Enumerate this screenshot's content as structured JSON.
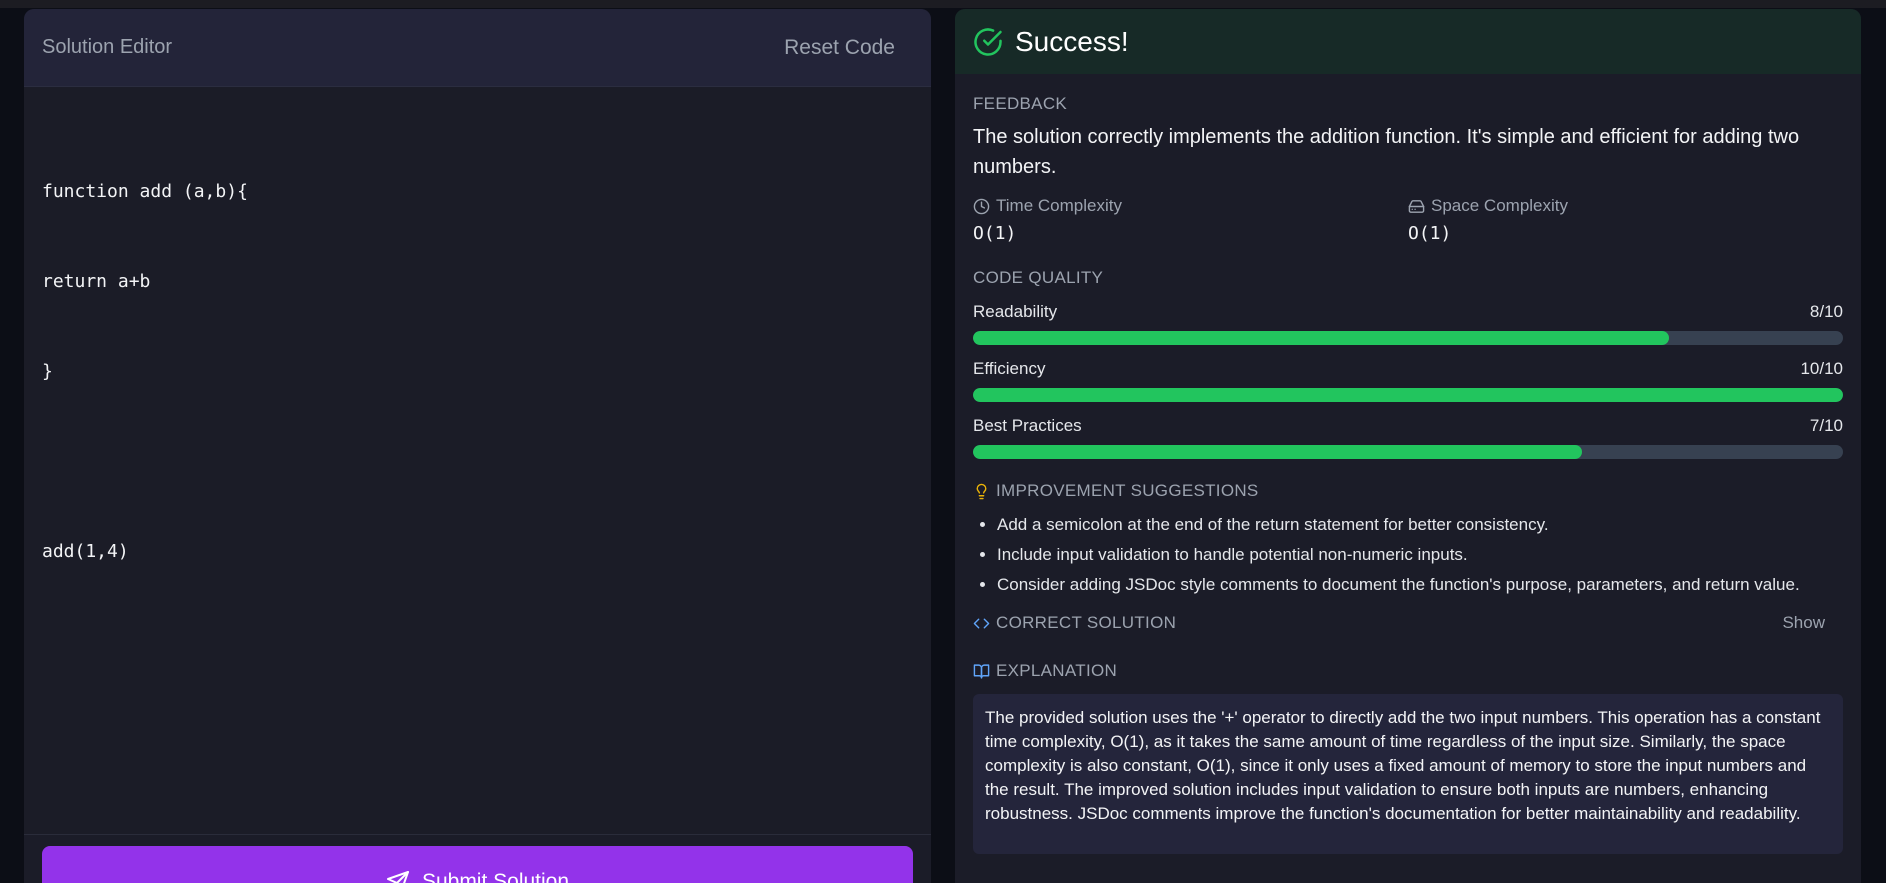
{
  "editor": {
    "title": "Solution Editor",
    "reset_label": "Reset Code",
    "code_lines": [
      "function add (a,b){",
      "return a+b",
      "}",
      "",
      "add(1,4)"
    ],
    "submit_label": "Submit Solution"
  },
  "result": {
    "status": "Success!",
    "feedback_label": "FEEDBACK",
    "feedback_text": "The solution correctly implements the addition function. It's simple and efficient for adding two numbers.",
    "time_label": "Time Complexity",
    "time_value": "O(1)",
    "space_label": "Space Complexity",
    "space_value": "O(1)",
    "quality_label": "CODE QUALITY",
    "metrics": [
      {
        "name": "Readability",
        "score": "8/10",
        "fraction": 0.8
      },
      {
        "name": "Efficiency",
        "score": "10/10",
        "fraction": 1.0
      },
      {
        "name": "Best Practices",
        "score": "7/10",
        "fraction": 0.7
      }
    ],
    "improvements_label": "IMPROVEMENT SUGGESTIONS",
    "suggestions": [
      "Add a semicolon at the end of the return statement for better consistency.",
      "Include input validation to handle potential non-numeric inputs.",
      "Consider adding JSDoc style comments to document the function's purpose, parameters, and return value."
    ],
    "correct_solution_label": "CORRECT SOLUTION",
    "show_label": "Show",
    "explanation_label": "EXPLANATION",
    "explanation_text": "The provided solution uses the '+' operator to directly add the two input numbers. This operation has a constant time complexity, O(1), as it takes the same amount of time regardless of the input size. Similarly, the space complexity is also constant, O(1), since it only uses a fixed amount of memory to store the input numbers and the result. The improved solution includes input validation to ensure both inputs are numbers, enhancing robustness. JSDoc comments improve the function's documentation for better maintainability and readability."
  },
  "colors": {
    "accent": "#9333ea",
    "success": "#22c55e",
    "bar_track": "#374151",
    "icon_blue": "#60a5fa",
    "icon_yellow": "#eab308"
  },
  "icons": {
    "status": "check-circle-icon",
    "time": "clock-icon",
    "space": "hard-drive-icon",
    "improvements": "lightbulb-icon",
    "correct_solution": "code-icon",
    "explanation": "book-open-icon",
    "submit": "send-icon"
  }
}
